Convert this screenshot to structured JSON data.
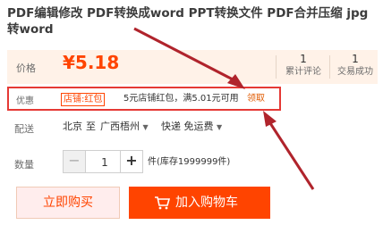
{
  "title": "PDF编辑修改 PDF转换成word PPT转换文件 PDF合并压缩 jpg转word",
  "price": {
    "label": "价格",
    "symbol": "¥",
    "value": "5.18",
    "stats": [
      {
        "number": "1",
        "text": "累计评论"
      },
      {
        "number": "1",
        "text": "交易成功"
      }
    ]
  },
  "promo": {
    "label": "优惠",
    "tag": "店铺:红包",
    "text": "5元店铺红包，满5.01元可用",
    "link": "领取"
  },
  "delivery": {
    "label": "配送",
    "from": "北京",
    "to_word": "至",
    "dest": "广西梧州",
    "method": "快递 免运费"
  },
  "quantity": {
    "label": "数量",
    "value": "1",
    "stock": "件(库存1999999件)"
  },
  "buttons": {
    "buy_now": "立即购买",
    "add_cart": "加入购物车"
  },
  "colors": {
    "accent": "#ff4400",
    "annotation": "#b0242c"
  }
}
